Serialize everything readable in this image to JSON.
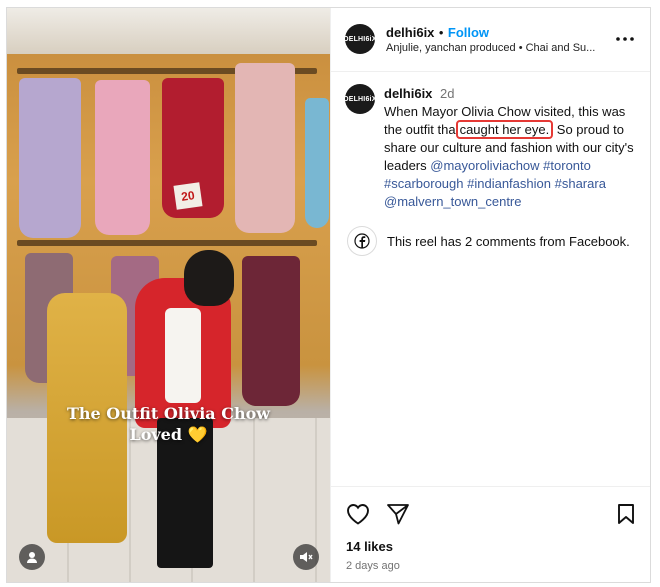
{
  "media": {
    "overlay_line1": "The Outfit Olivia Chow",
    "overlay_line2": "Loved 💛",
    "price_tag": "20"
  },
  "header": {
    "avatar_text": "DELHI6iX",
    "username": "delhi6ix",
    "separator": "•",
    "follow_label": "Follow",
    "subtitle": "Anjulie, yanchan produced • Chai and Su..."
  },
  "caption": {
    "avatar_text": "DELHI6iX",
    "username": "delhi6ix",
    "age": "2d",
    "text_before": "When Mayor Olivia Chow visited, this was the outfit tha",
    "highlight": "caught her eye.",
    "text_after": " So proud to share our culture and fashion with our city's leaders ",
    "tags": [
      "@mayoroliviachow",
      "#toronto",
      "#scarborough",
      "#indianfashion",
      "#sharara",
      "@malvern_town_centre"
    ]
  },
  "facebook_note": "This reel has 2 comments from Facebook.",
  "footer": {
    "likes": "14 likes",
    "time": "2 days ago"
  },
  "colors": {
    "link": "#0095f6",
    "hashtag": "#385898",
    "highlight_border": "#e53935"
  }
}
